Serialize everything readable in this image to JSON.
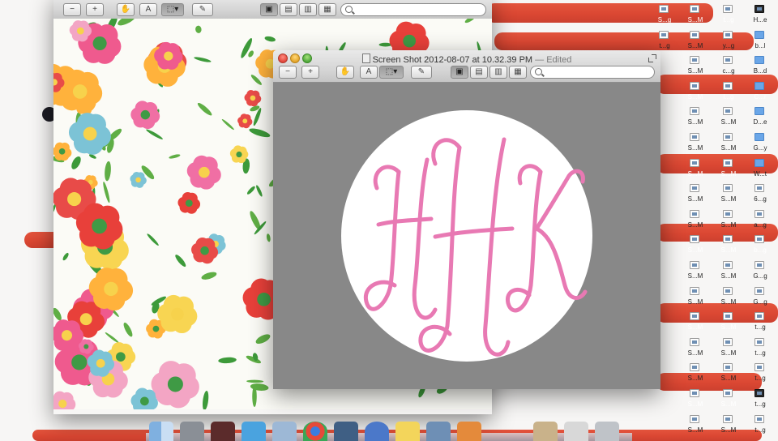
{
  "desktop": {
    "icons": [
      {
        "id": "d-r0-a",
        "label": "S...g",
        "kind": "file",
        "sel": true
      },
      {
        "id": "d-r0-b",
        "label": "S...M",
        "kind": "file",
        "sel": true
      },
      {
        "id": "d-r0-c",
        "label": "t...g",
        "kind": "file",
        "sel": true
      },
      {
        "id": "d-r0-d",
        "label": "H...e",
        "kind": "dark",
        "sel": false
      },
      {
        "id": "d-r1-a",
        "label": "t...g",
        "kind": "file",
        "sel": false
      },
      {
        "id": "d-r1-b",
        "label": "S...M",
        "kind": "file",
        "sel": false
      },
      {
        "id": "d-r1-c",
        "label": "y...g",
        "kind": "file",
        "sel": false
      },
      {
        "id": "d-r1-d",
        "label": "b...l",
        "kind": "folder",
        "sel": false
      },
      {
        "id": "d-r2-b",
        "label": "S...M",
        "kind": "file",
        "sel": false
      },
      {
        "id": "d-r2-c",
        "label": "c...g",
        "kind": "file",
        "sel": false
      },
      {
        "id": "d-r2-d",
        "label": "B...d",
        "kind": "folder",
        "sel": false
      },
      {
        "id": "d-r3-b",
        "label": "S...M",
        "kind": "file",
        "sel": true
      },
      {
        "id": "d-r3-c",
        "label": "l...g",
        "kind": "file",
        "sel": true
      },
      {
        "id": "d-r3-d",
        "label": "C...r",
        "kind": "folder",
        "sel": true
      },
      {
        "id": "d-r4-b",
        "label": "S...M",
        "kind": "file",
        "sel": false
      },
      {
        "id": "d-r4-c",
        "label": "S...M",
        "kind": "file",
        "sel": false
      },
      {
        "id": "d-r4-d",
        "label": "D...e",
        "kind": "folder",
        "sel": false
      },
      {
        "id": "d-r5-b",
        "label": "S...M",
        "kind": "file",
        "sel": false
      },
      {
        "id": "d-r5-c",
        "label": "S...M",
        "kind": "file",
        "sel": false
      },
      {
        "id": "d-r5-d",
        "label": "G...y",
        "kind": "folder",
        "sel": false
      },
      {
        "id": "d-r6-b",
        "label": "S...M",
        "kind": "file",
        "sel": true
      },
      {
        "id": "d-r6-c",
        "label": "S...M",
        "kind": "file",
        "sel": true
      },
      {
        "id": "d-r6-d",
        "label": "W...t",
        "kind": "folder",
        "sel": false
      },
      {
        "id": "d-r7-b",
        "label": "S...M",
        "kind": "file",
        "sel": false
      },
      {
        "id": "d-r7-c",
        "label": "S...M",
        "kind": "file",
        "sel": false
      },
      {
        "id": "d-r7-d",
        "label": "6...g",
        "kind": "file",
        "sel": false
      },
      {
        "id": "d-r8-b",
        "label": "S...M",
        "kind": "file",
        "sel": false
      },
      {
        "id": "d-r8-c",
        "label": "S...M",
        "kind": "file",
        "sel": false
      },
      {
        "id": "d-r8-d",
        "label": "a...g",
        "kind": "file",
        "sel": false
      },
      {
        "id": "d-r9-b",
        "label": "S...M",
        "kind": "file",
        "sel": true
      },
      {
        "id": "d-r9-c",
        "label": "S...M",
        "kind": "file",
        "sel": true
      },
      {
        "id": "d-r9-d",
        "label": "b...g",
        "kind": "file",
        "sel": true
      },
      {
        "id": "d-r10-b",
        "label": "S...M",
        "kind": "file",
        "sel": false
      },
      {
        "id": "d-r10-c",
        "label": "S...M",
        "kind": "file",
        "sel": false
      },
      {
        "id": "d-r10-d",
        "label": "G...g",
        "kind": "file",
        "sel": false
      },
      {
        "id": "d-r11-b",
        "label": "S...M",
        "kind": "file",
        "sel": false
      },
      {
        "id": "d-r11-c",
        "label": "S...M",
        "kind": "file",
        "sel": false
      },
      {
        "id": "d-r11-d",
        "label": "G...g",
        "kind": "file",
        "sel": false
      },
      {
        "id": "d-r12-b",
        "label": "S...M",
        "kind": "file",
        "sel": true
      },
      {
        "id": "d-r12-c",
        "label": "S...M",
        "kind": "file",
        "sel": true
      },
      {
        "id": "d-r12-d",
        "label": "t...g",
        "kind": "file",
        "sel": false
      },
      {
        "id": "d-r13-b",
        "label": "S...M",
        "kind": "file",
        "sel": false
      },
      {
        "id": "d-r13-c",
        "label": "S...M",
        "kind": "file",
        "sel": false
      },
      {
        "id": "d-r13-d",
        "label": "t...g",
        "kind": "file",
        "sel": false
      },
      {
        "id": "d-r14-b",
        "label": "S...M",
        "kind": "file",
        "sel": false
      },
      {
        "id": "d-r14-c",
        "label": "S...M",
        "kind": "file",
        "sel": false
      },
      {
        "id": "d-r14-d",
        "label": "t...g",
        "kind": "file",
        "sel": false
      },
      {
        "id": "d-r15-b",
        "label": "S...M",
        "kind": "file",
        "sel": true
      },
      {
        "id": "d-r15-c",
        "label": "S...M",
        "kind": "file",
        "sel": true
      },
      {
        "id": "d-r15-d",
        "label": "t...g",
        "kind": "dark",
        "sel": false
      },
      {
        "id": "d-r16-b",
        "label": "S...M",
        "kind": "file",
        "sel": false
      },
      {
        "id": "d-r16-c",
        "label": "S...M",
        "kind": "file",
        "sel": false
      },
      {
        "id": "d-r16-d",
        "label": "t...g",
        "kind": "file",
        "sel": false
      }
    ]
  },
  "back_window": {
    "toolbar_icons": [
      "zoom-out-icon",
      "zoom-in-icon",
      "hand-icon",
      "text-select-icon",
      "rect-select-icon",
      "annotate-icon",
      "view-single-icon",
      "view-two-icon",
      "view-four-icon",
      "contact-sheet-icon"
    ],
    "image": "floral pattern"
  },
  "front_window": {
    "title": "Screen Shot 2012-08-07 at 10.32.39 PM",
    "edited": " — Edited",
    "search_placeholder": "",
    "monogram": "HHK",
    "colors": {
      "canvas": "#888888",
      "circle": "#ffffff",
      "monogram": "#e879b3"
    }
  },
  "dock": {
    "apps": [
      "finder",
      "system-preferences",
      "game",
      "twitter",
      "preview",
      "chrome",
      "iphoto",
      "itunes",
      "stickies",
      "photo-booth",
      "brush",
      "archive",
      "files",
      "trash"
    ]
  },
  "colors": {
    "stripe": "#dc3b26",
    "desktop": "#f7f6f5"
  }
}
